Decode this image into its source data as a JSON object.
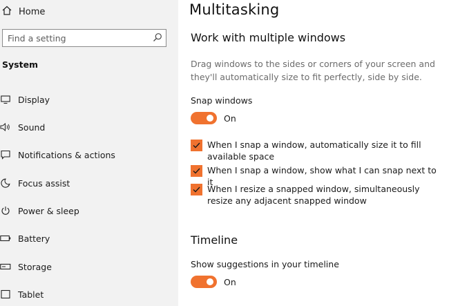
{
  "sidebar": {
    "home_label": "Home",
    "search_placeholder": "Find a setting",
    "section_label": "System",
    "items": [
      {
        "label": "Display",
        "icon": "monitor-icon"
      },
      {
        "label": "Sound",
        "icon": "speaker-icon"
      },
      {
        "label": "Notifications & actions",
        "icon": "notification-icon"
      },
      {
        "label": "Focus assist",
        "icon": "moon-icon"
      },
      {
        "label": "Power & sleep",
        "icon": "power-icon"
      },
      {
        "label": "Battery",
        "icon": "battery-icon"
      },
      {
        "label": "Storage",
        "icon": "storage-icon"
      },
      {
        "label": "Tablet",
        "icon": "tablet-icon"
      }
    ]
  },
  "main": {
    "title": "Multitasking",
    "windows_section": {
      "heading": "Work with multiple windows",
      "description": "Drag windows to the sides or corners of your screen and they'll automatically size to fit perfectly, side by side.",
      "snap_label": "Snap windows",
      "snap_state": "On",
      "checkboxes": [
        {
          "label": "When I snap a window, automatically size it to fill available space",
          "checked": true
        },
        {
          "label": "When I snap a window, show what I can snap next to it",
          "checked": true
        },
        {
          "label": "When I resize a snapped window, simultaneously resize any adjacent snapped window",
          "checked": true
        }
      ]
    },
    "timeline_section": {
      "heading": "Timeline",
      "suggestions_label": "Show suggestions in your timeline",
      "suggestions_state": "On"
    }
  },
  "colors": {
    "accent": "#f0722f",
    "sidebar_bg": "#f2f2f2",
    "description_text": "#6b6b6b"
  }
}
